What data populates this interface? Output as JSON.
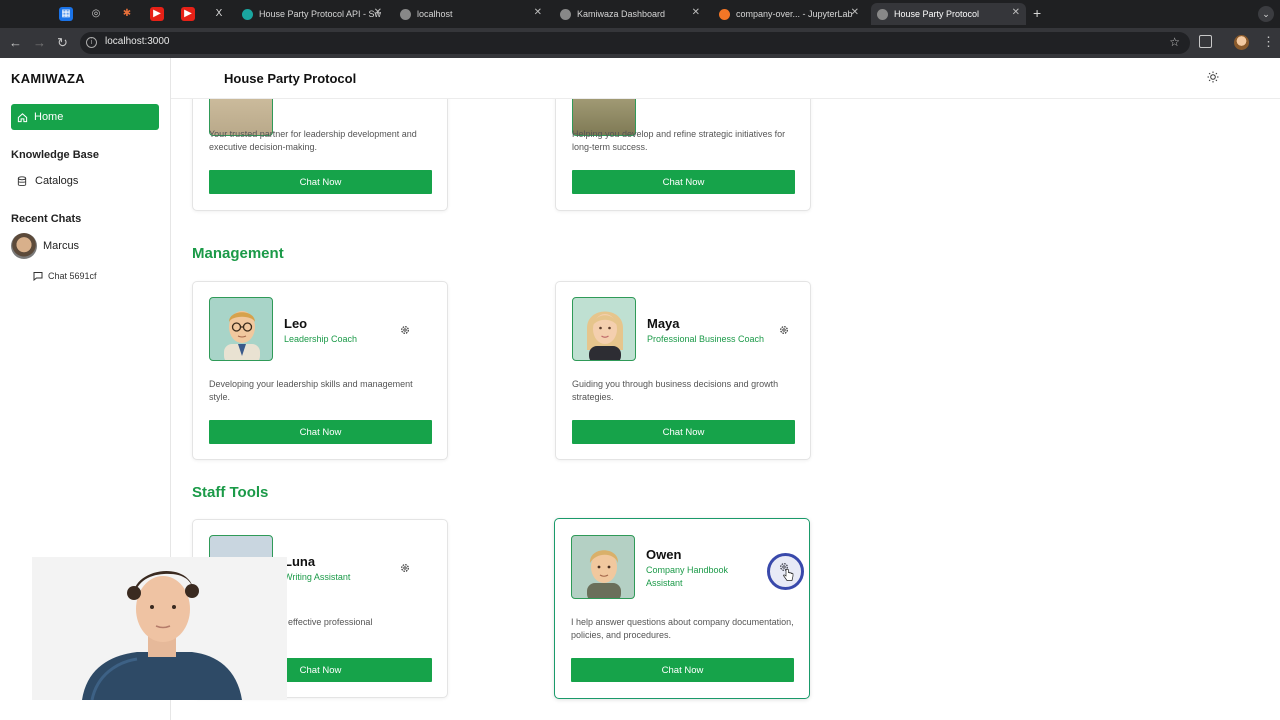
{
  "browser": {
    "tabs": [
      {
        "label": "House Party Protocol API - Sw",
        "fav": "#1aa6a0"
      },
      {
        "label": "localhost",
        "fav": "#888888"
      },
      {
        "label": "Kamiwaza Dashboard",
        "fav": "#888888"
      },
      {
        "label": "company-over... - JupyterLab",
        "fav": "#f37626"
      },
      {
        "label": "House Party Protocol",
        "fav": "#888888",
        "active": true
      }
    ],
    "url": "localhost:3000"
  },
  "sidebar": {
    "brand": "KAMIWAZA",
    "home": "Home",
    "knowledge_base": "Knowledge Base",
    "catalogs": "Catalogs",
    "recent_chats": "Recent Chats",
    "recent_user": "Marcus",
    "chat_item": "Chat 5691cf"
  },
  "header": {
    "title": "House Party Protocol"
  },
  "top_cards": [
    {
      "desc": "Your trusted partner for leadership development and executive decision-making.",
      "button": "Chat Now"
    },
    {
      "desc": "Helping you develop and refine strategic initiatives for long-term success.",
      "button": "Chat Now"
    }
  ],
  "sections": {
    "management": "Management",
    "staff_tools": "Staff Tools"
  },
  "management_cards": [
    {
      "name": "Leo",
      "role": "Leadership Coach",
      "desc": "Developing your leadership skills and management style.",
      "button": "Chat Now"
    },
    {
      "name": "Maya",
      "role": "Professional Business Coach",
      "desc": "Guiding you through business decisions and growth strategies.",
      "button": "Chat Now"
    }
  ],
  "staff_cards": [
    {
      "name": "Luna",
      "role": "Writing Assistant",
      "desc": "effective professional",
      "button": "Chat Now"
    },
    {
      "name": "Owen",
      "role": "Company Handbook Assistant",
      "desc": "I help answer questions about company documentation, policies, and procedures.",
      "button": "Chat Now"
    }
  ],
  "colors": {
    "accent": "#16a34a",
    "heading": "#1b9a48",
    "highlight_border": "#1a9a6a",
    "cursor_ring": "#3949ab"
  }
}
